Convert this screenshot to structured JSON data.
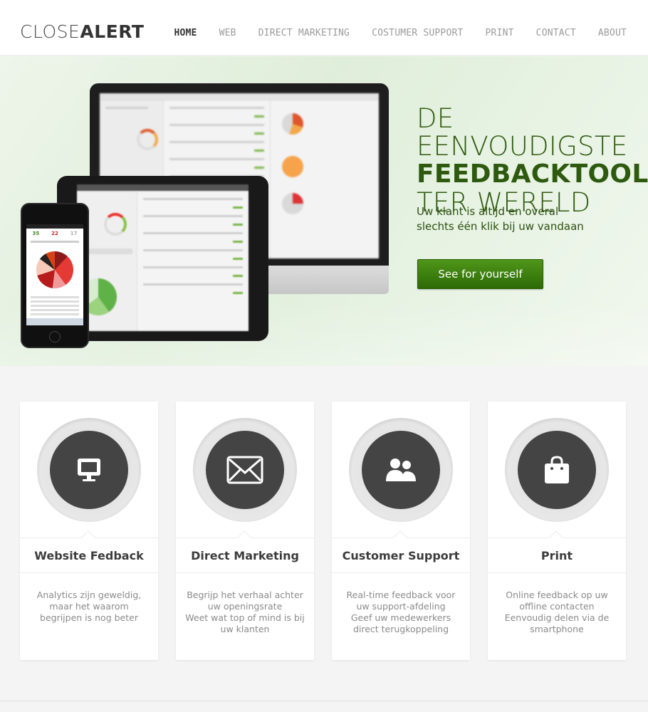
{
  "header": {
    "logo_light": "CLOSE",
    "logo_bold": "ALERT",
    "nav": [
      {
        "label": "HOME",
        "active": true
      },
      {
        "label": "WEB",
        "active": false
      },
      {
        "label": "DIRECT MARKETING",
        "active": false
      },
      {
        "label": "COSTUMER SUPPORT",
        "active": false
      },
      {
        "label": "PRINT",
        "active": false
      },
      {
        "label": "CONTACT",
        "active": false
      },
      {
        "label": "ABOUT",
        "active": false
      }
    ]
  },
  "hero": {
    "headline_1": "DE EENVOUDIGSTE",
    "headline_2": "FEEDBACKTOOL",
    "headline_3": "TER WERELD",
    "sub_1": "Uw klant is altijd en overal",
    "sub_2": "slechts één klik bij uw vandaan",
    "cta_label": "See for yourself",
    "phone_stats": [
      "35",
      "22",
      "17"
    ]
  },
  "colors": {
    "accent_green": "#3f8512",
    "headline_green": "#2e5a0f",
    "icon_disc": "#444444"
  },
  "cards": [
    {
      "title": "Website Fedback",
      "icon": "monitor-icon",
      "desc": [
        "Analytics zijn geweldig, maar het waarom begrijpen is nog beter"
      ]
    },
    {
      "title": "Direct Marketing",
      "icon": "envelope-icon",
      "desc": [
        "Begrijp het verhaal achter uw openingsrate",
        "Weet wat top of mind is bij uw klanten"
      ]
    },
    {
      "title": "Customer Support",
      "icon": "users-icon",
      "desc": [
        "Real-time feedback voor uw support-afdeling",
        "Geef uw medewerkers direct terugkoppeling"
      ]
    },
    {
      "title": "Print",
      "icon": "shopping-bag-icon",
      "desc": [
        "Online feedback op uw offline contacten",
        "Eenvoudig delen via de smartphone"
      ]
    }
  ]
}
